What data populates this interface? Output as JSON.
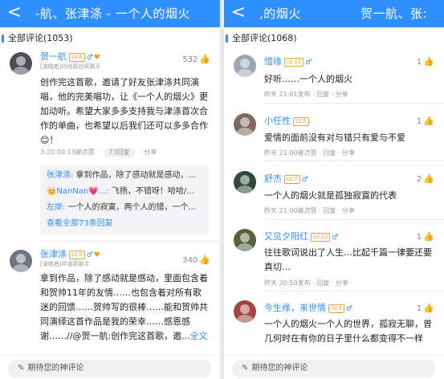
{
  "left": {
    "header": {
      "back": "<",
      "title": "-航、张津涤 - 一个人的烟火"
    },
    "section": "全部评论(1053)",
    "comments": [
      {
        "name": "贺一航",
        "badge": "LV.6",
        "sex": "♂",
        "vip": "♥",
        "tag": "[演唱者]内地原创男歌手",
        "likes": "532",
        "text": "创作完这首歌，邀请了好友张津涤共同演唱，他的完美唱功，让《一个人的烟火》更加动听。希望大家多多支持我与津涤首次合作的单曲，也希望以后我们还可以多多合作😊！",
        "meta_time": "3-20 00:13被点赞",
        "meta_sep": "·",
        "meta_reply": "73回复",
        "meta_share": "分享",
        "replies": [
          {
            "author": "张津涤:",
            "text": " 拿到作品，除了感动就是感动，..."
          },
          {
            "author": "👑NanNan💗...:",
            "text": " 飞扬，不错呀！哈哈/..."
          },
          {
            "author": "左岸:",
            "text": " 一个人的寂寞，两个人的错，一个..."
          }
        ],
        "replies_more": "查看全部73条回复"
      },
      {
        "name": "张津涤",
        "badge": "LV.8",
        "sex": "♂",
        "vip": "♥",
        "tag": "[演唱者]华语男歌手",
        "likes": "340",
        "text": "拿到作品，除了感动就是感动，里面包含着和贺帅11年的友情……也包含着对所有歌迷的回馈……贺帅写的很棒……能和贺帅共同演绎这首作品是我的荣幸……感恩感谢……//@贺一航:创作完这首歌，邀...",
        "more": "全文"
      }
    ],
    "input_placeholder": "期待您的神评论"
  },
  "right": {
    "header": {
      "back": "<",
      "title_a": ",的烟火",
      "title_b": "贺一航、张:"
    },
    "section": "全部评论(1068)",
    "comments": [
      {
        "name": "惜缘",
        "badge": "LV.12",
        "sex": "♂",
        "likes": "1",
        "text": "好听……一个人的烟火",
        "meta": "昨天 21:01发布 · 回复 · 分享"
      },
      {
        "name": "小任性",
        "badge": "LV.5",
        "sex": "",
        "likes": "1",
        "text": "爱情的面前没有对与错只有爱与不爱",
        "meta": "昨天 21:00被点赞 · 回复 · 分享"
      },
      {
        "name": "舒杰",
        "badge": "LV.7",
        "sex": "♂",
        "likes": "2",
        "text": "一个人的烟火就是孤独寂寞的代表",
        "meta": "昨天 21:00被点赞 · 回复 · 分享"
      },
      {
        "name": "又见夕阳红",
        "badge": "LV.10",
        "sex": "♂",
        "likes": "1",
        "text": "往往歌词说出了人生…比起千篇一律要还要真切…",
        "meta": "昨天 20:50发布 · 回复 · 分享"
      },
      {
        "name": "今生缘，来世情",
        "badge": "LV.3",
        "sex": "♂",
        "likes": "1",
        "text": "一个人的烟火一个人的世界，孤寂无聊，曾几何时在有你的日子里什么都变得不一样"
      }
    ],
    "input_placeholder": "期待您的神评论"
  },
  "icons": {
    "thumb": "👍",
    "pen": "✎"
  },
  "colors": {
    "accent": "#2f8fff",
    "header_bg": "#2f8fff",
    "badge": "#e8a33d"
  }
}
